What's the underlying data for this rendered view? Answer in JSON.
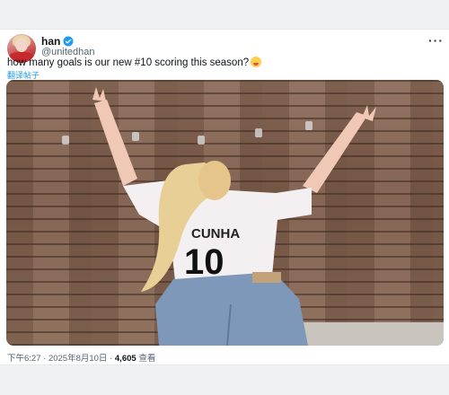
{
  "tweet": {
    "display_name": "han",
    "handle": "@unitedhan",
    "text": "how many goals is our new #10 scoring this season?",
    "emoji": "smiling-face-emoji",
    "translate_label": "翻译帖子",
    "more_icon": "more-dots-icon",
    "verified_icon": "verified-badge-icon",
    "verified_color": "#1d9bf0"
  },
  "photo": {
    "shirt_name": "CUNHA",
    "shirt_number": "10"
  },
  "meta": {
    "time": "下午6:27",
    "date": "2025年8月10日",
    "separator": "·",
    "views_count": "4,605",
    "views_label": "查看"
  }
}
